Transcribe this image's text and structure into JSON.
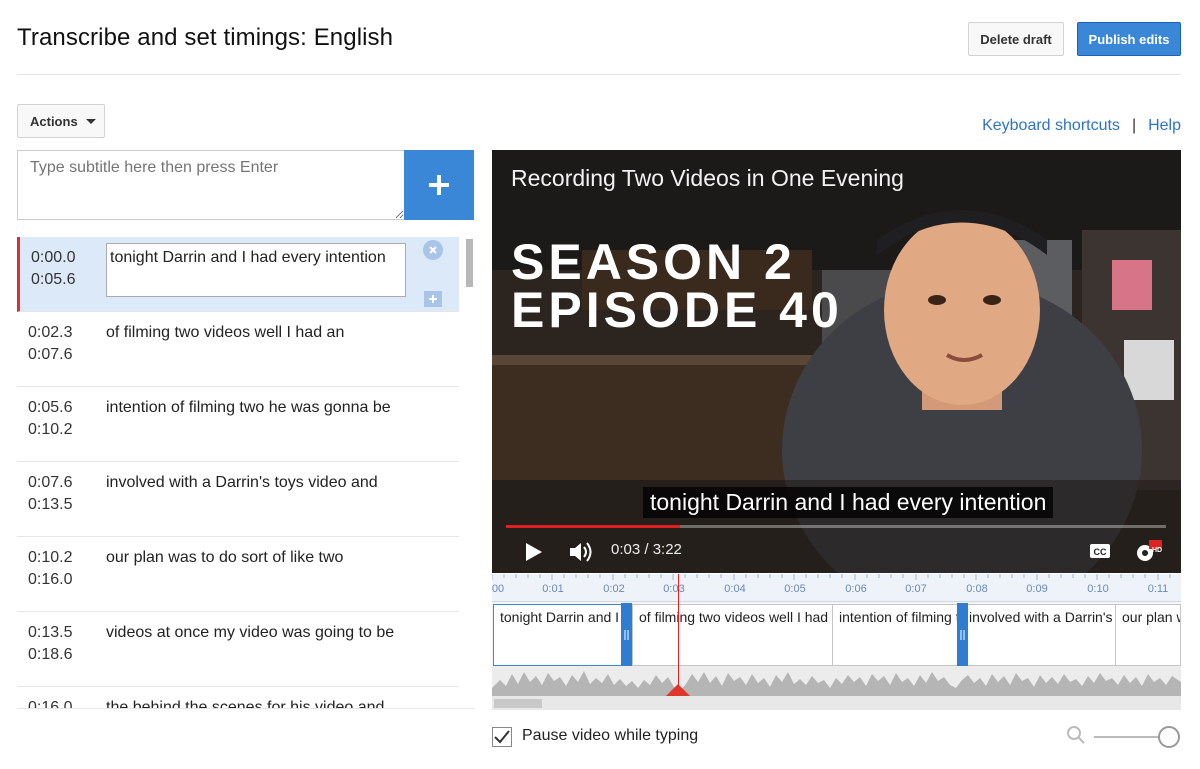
{
  "header": {
    "title": "Transcribe and set timings: English",
    "delete_label": "Delete draft",
    "publish_label": "Publish edits"
  },
  "toolbar": {
    "actions_label": "Actions",
    "keyboard_shortcuts": "Keyboard shortcuts",
    "separator": "|",
    "help": "Help"
  },
  "subtitle_input": {
    "placeholder": "Type subtitle here then press Enter",
    "add_icon": "plus-icon"
  },
  "subtitles": [
    {
      "start": "0:00.0",
      "end": "0:05.6",
      "text": "tonight Darrin and I had every intention",
      "active": true
    },
    {
      "start": "0:02.3",
      "end": "0:07.6",
      "text": "of filming two videos well I had an"
    },
    {
      "start": "0:05.6",
      "end": "0:10.2",
      "text": "intention of filming two he was gonna be"
    },
    {
      "start": "0:07.6",
      "end": "0:13.5",
      "text": "involved with a Darrin's toys video and"
    },
    {
      "start": "0:10.2",
      "end": "0:16.0",
      "text": "our plan was to do sort of like two"
    },
    {
      "start": "0:13.5",
      "end": "0:18.6",
      "text": "videos at once my video was going to be"
    },
    {
      "start": "0:16.0",
      "end": "",
      "text": "the behind the scenes for his video and"
    }
  ],
  "player": {
    "video_title": "Recording Two Videos in One Evening",
    "overlay_line1": "SEASON 2",
    "overlay_line2": "EPISODE 40",
    "caption": "tonight Darrin and I had every intention",
    "current_time": "0:03",
    "duration": "3:22",
    "time_readout": "0:03 / 3:22",
    "progress_fraction": 0.263,
    "icons": [
      "play-icon",
      "volume-icon",
      "cc-icon",
      "settings-hd-icon"
    ],
    "hd_badge": "HD"
  },
  "timeline": {
    "ticks": [
      "00",
      "0:01",
      "0:02",
      "0:03",
      "0:04",
      "0:05",
      "0:06",
      "0:07",
      "0:08",
      "0:09",
      "0:10",
      "0:11"
    ],
    "segments": [
      {
        "text": "tonight Darrin and I had every intention",
        "active": true
      },
      {
        "text": "of filming two videos well I had an"
      },
      {
        "text": "intention of filming two he was gonna be"
      },
      {
        "text": "involved with a Darrin's toys video and"
      },
      {
        "text": "our plan was to do sort of like two"
      }
    ]
  },
  "footer": {
    "pause_label": "Pause video while typing",
    "pause_checked": true,
    "zoom_icon": "zoom-icon",
    "zoom_level": 1.0
  },
  "colors": {
    "accent": "#3a87d8",
    "active_row": "#dbe9f9",
    "active_marker": "#d0333b",
    "playhead": "#dd2222"
  }
}
